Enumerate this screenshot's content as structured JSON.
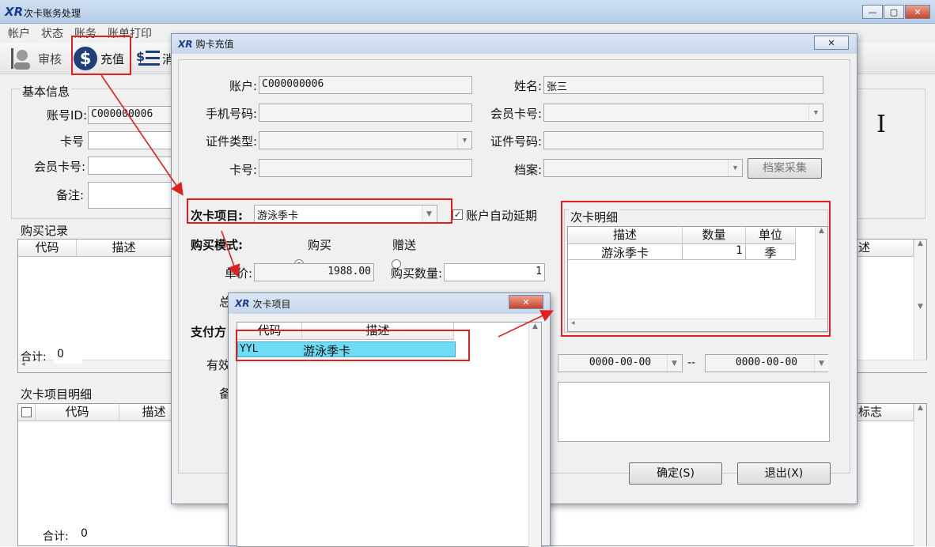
{
  "main_window": {
    "title": "次卡账务处理",
    "logo": "XR",
    "controls": {
      "minimize": "—",
      "restore": "▢",
      "close": "✕"
    }
  },
  "menu": [
    "帐户",
    "状态",
    "账务",
    "账单打印"
  ],
  "toolbar": {
    "audit_label": "审核",
    "recharge_label": "充值",
    "third_label": "消"
  },
  "basic_info": {
    "title": "基本信息",
    "account_id_label": "账号ID:",
    "account_id_value": "C000000006",
    "card_no_label": "卡号",
    "member_card_label": "会员卡号:",
    "remark_label": "备注:",
    "right_glyph": "I"
  },
  "purchase_records": {
    "title": "购买记录",
    "columns": [
      "代码",
      "描述"
    ],
    "right_column": "述",
    "total_label": "合计:",
    "total_value": "0"
  },
  "card_items_detail": {
    "title": "次卡项目明细",
    "columns": [
      "代码",
      "描述"
    ],
    "right_column": "标志",
    "total_label": "合计:",
    "total_value": "0"
  },
  "recharge_dialog": {
    "title": "购卡充值",
    "logo": "XR",
    "close": "✕",
    "account_label": "账户:",
    "account_value": "C000000006",
    "name_label": "姓名:",
    "name_value": "张三",
    "phone_label": "手机号码:",
    "member_card_label": "会员卡号:",
    "id_type_label": "证件类型:",
    "id_no_label": "证件号码:",
    "card_no_label": "卡号:",
    "archive_label": "档案:",
    "archive_button": "档案采集",
    "card_item_label": "次卡项目:",
    "card_item_value": "游泳季卡",
    "auto_extend_label": "账户自动延期",
    "auto_extend_checked": "✓",
    "buy_mode_label": "购买模式:",
    "buy_option": "购买",
    "gift_option": "赠送",
    "unit_price_label": "单价:",
    "unit_price_value": "1988.00",
    "quantity_label": "购买数量:",
    "quantity_value": "1",
    "total_label_partial": "总",
    "pay_label_partial": "支付方",
    "valid_label_partial": "有效",
    "remark_label_partial": "备",
    "date_from": "0000-00-00",
    "date_sep": "--",
    "date_to": "0000-00-00",
    "confirm_button": "确定(S)",
    "exit_button": "退出(X)",
    "detail": {
      "title": "次卡明细",
      "columns": [
        "描述",
        "数量",
        "单位"
      ],
      "rows": [
        {
          "desc": "游泳季卡",
          "qty": "1",
          "unit": "季"
        }
      ]
    }
  },
  "item_dialog": {
    "title": "次卡项目",
    "logo": "XR",
    "close": "✕",
    "columns": [
      "代码",
      "描述"
    ],
    "rows": [
      {
        "code": "YYL",
        "desc": "游泳季卡"
      }
    ]
  },
  "colors": {
    "highlight_row": "#6fdcf5",
    "annotation_red": "#e02020",
    "titlebar": "#c7d7eb"
  }
}
